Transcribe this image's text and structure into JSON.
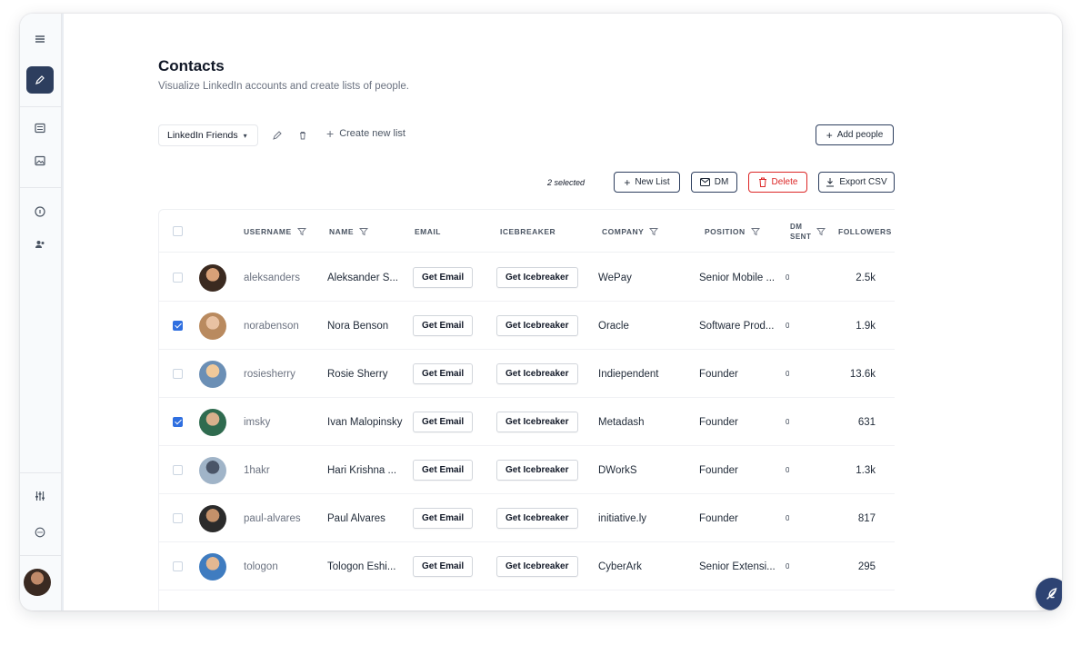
{
  "header": {
    "title": "Contacts",
    "subtitle": "Visualize LinkedIn accounts and create lists of people."
  },
  "toolbar": {
    "list_selector": "LinkedIn Friends",
    "create_list": "Create new list",
    "add_people": "Add people",
    "selected_count": "2 selected",
    "new_list": "New List",
    "dm": "DM",
    "delete": "Delete",
    "export_csv": "Export CSV"
  },
  "table": {
    "columns": {
      "username": "USERNAME",
      "name": "NAME",
      "email": "EMAIL",
      "icebreaker": "ICEBREAKER",
      "company": "COMPANY",
      "position": "POSITION",
      "dm_sent_1": "DM",
      "dm_sent_2": "SENT",
      "followers": "FOLLOWERS"
    },
    "email_action": "Get Email",
    "icebreaker_action": "Get Icebreaker",
    "rows": [
      {
        "checked": false,
        "username": "aleksanders",
        "name": "Aleksander S...",
        "company": "WePay",
        "position": "Senior Mobile ...",
        "dm_sent": "0",
        "followers": "2.5k",
        "avatar_colors": [
          "#d9a178",
          "#3b2a20"
        ]
      },
      {
        "checked": true,
        "username": "norabenson",
        "name": "Nora Benson",
        "company": "Oracle",
        "position": "Software Prod...",
        "dm_sent": "0",
        "followers": "1.9k",
        "avatar_colors": [
          "#e9c2a3",
          "#b98a5f"
        ]
      },
      {
        "checked": false,
        "username": "rosiesherry",
        "name": "Rosie Sherry",
        "company": "Indiependent",
        "position": "Founder",
        "dm_sent": "0",
        "followers": "13.6k",
        "avatar_colors": [
          "#f0c99a",
          "#6b8fb5"
        ]
      },
      {
        "checked": true,
        "username": "imsky",
        "name": "Ivan Malopinsky",
        "company": "Metadash",
        "position": "Founder",
        "dm_sent": "0",
        "followers": "631",
        "avatar_colors": [
          "#d8b08c",
          "#2f6b4f"
        ]
      },
      {
        "checked": false,
        "username": "1hakr",
        "name": "Hari Krishna ...",
        "company": "DWorkS",
        "position": "Founder",
        "dm_sent": "0",
        "followers": "1.3k",
        "avatar_colors": [
          "#4a5568",
          "#a0b4c8"
        ]
      },
      {
        "checked": false,
        "username": "paul-alvares",
        "name": "Paul Alvares",
        "company": "initiative.ly",
        "position": "Founder",
        "dm_sent": "0",
        "followers": "817",
        "avatar_colors": [
          "#c4916a",
          "#2b2b2b"
        ]
      },
      {
        "checked": false,
        "username": "tologon",
        "name": "Tologon Eshi...",
        "company": "CyberArk",
        "position": "Senior Extensi...",
        "dm_sent": "0",
        "followers": "295",
        "avatar_colors": [
          "#e4b892",
          "#3f7cc0"
        ]
      }
    ]
  },
  "icons": {
    "menu": "hamburger-icon",
    "edit": "pencil-icon",
    "list": "list-icon",
    "image": "image-icon",
    "info": "info-icon",
    "users": "users-icon",
    "settings": "sliders-icon",
    "support": "chat-icon",
    "fab": "feather-icon"
  },
  "colors": {
    "accent": "#2d3e5e",
    "check": "#2f6fe0",
    "danger": "#dc2626",
    "fab": "#2d4373"
  }
}
